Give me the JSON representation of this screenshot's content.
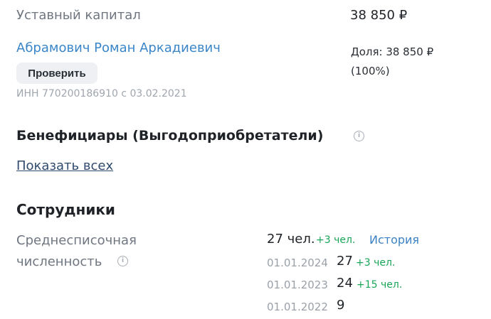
{
  "capital": {
    "label": "Уставный капитал",
    "value": "38 850 ₽"
  },
  "owner": {
    "name": "Абрамович Роман Аркадиевич",
    "check_button": "Проверить",
    "inn": "ИНН 770200186910 с 03.02.2021",
    "share_line1": "Доля: 38 850 ₽",
    "share_line2": "(100%)"
  },
  "beneficiaries": {
    "title": "Бенефициары (Выгодоприобретатели)",
    "show_all": "Показать всех"
  },
  "employees": {
    "title": "Сотрудники",
    "avg_label_line1": "Среднесписочная",
    "avg_label_line2": "численность",
    "current_count": "27 чел.",
    "current_delta": "+3 чел.",
    "history_link": "История",
    "history": [
      {
        "date": "01.01.2024",
        "count": "27",
        "delta": "+3 чел."
      },
      {
        "date": "01.01.2023",
        "count": "24",
        "delta": "+15 чел."
      },
      {
        "date": "01.01.2022",
        "count": "9",
        "delta": ""
      }
    ]
  },
  "colors": {
    "link": "#3a86c8",
    "positive": "#18a557",
    "muted": "#9aa1a9"
  },
  "icons": [
    "info-icon"
  ]
}
